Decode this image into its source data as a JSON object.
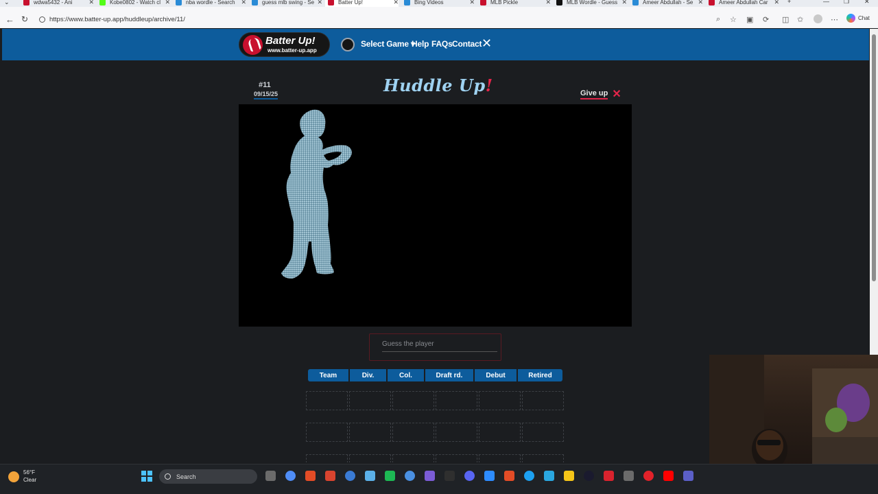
{
  "browser": {
    "tabs": [
      {
        "label": "wdwa5432 - Ani",
        "fav": "#c8102e",
        "active": false
      },
      {
        "label": "Kobe0802 - Watch cl",
        "fav": "#53fc18",
        "active": false
      },
      {
        "label": "nba wordle - Search",
        "fav": "#2a8bd6",
        "active": false
      },
      {
        "label": "guess mlb swing - Se",
        "fav": "#2a8bd6",
        "active": false
      },
      {
        "label": "Batter Up!",
        "fav": "#c8102e",
        "active": true
      },
      {
        "label": "Bing Videos",
        "fav": "#2a8bd6",
        "active": false
      },
      {
        "label": "MLB Pickle",
        "fav": "#c8102e",
        "active": false
      },
      {
        "label": "MLB Wordle - Guess",
        "fav": "#111111",
        "active": false
      },
      {
        "label": "Ameer Abdullah - Se",
        "fav": "#2a8bd6",
        "active": false
      },
      {
        "label": "Ameer Abdullah Car",
        "fav": "#c8102e",
        "active": false
      }
    ],
    "url": "https://www.batter-up.app/huddleup/archive/11/",
    "chat_label": "Chat"
  },
  "site": {
    "logo_title": "Batter Up!",
    "logo_url": "www.batter-up.app",
    "nav": {
      "select_game": "Select Game ▾",
      "help": "Help",
      "faqs": "FAQs",
      "contact": "Contact"
    }
  },
  "game": {
    "title": "Huddle Up",
    "title_bang": "!",
    "puzzle_number": "#11",
    "puzzle_date": "09/15/25",
    "give_up": "Give up",
    "guess_placeholder": "Guess the player",
    "columns": [
      "Team",
      "Div.",
      "Col.",
      "Draft rd.",
      "Debut",
      "Retired"
    ],
    "empty_rows": 3
  },
  "taskbar": {
    "weather_temp": "56°F",
    "weather_desc": "Clear",
    "search_label": "Search"
  },
  "colors": {
    "nav_blue": "#0d5c9c",
    "accent_red": "#e4254a",
    "title_blue": "#9fd2f1",
    "silhouette": "#8fb3c4"
  }
}
